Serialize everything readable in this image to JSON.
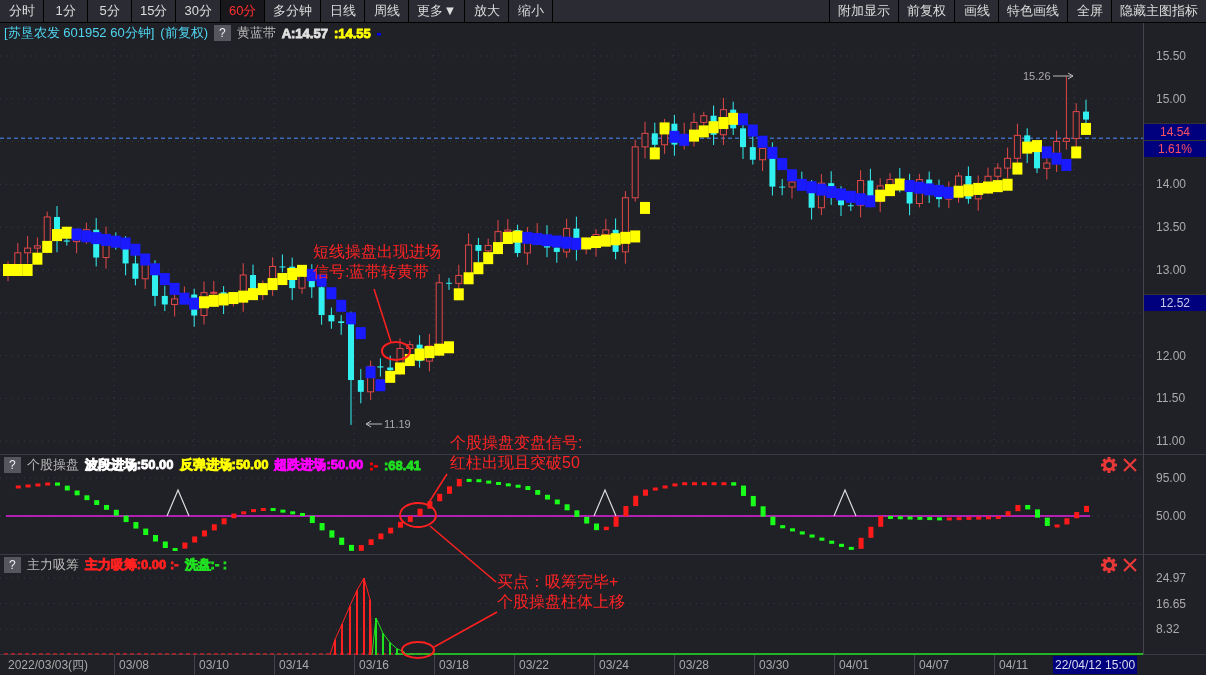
{
  "toolbar": {
    "periods": [
      {
        "label": "分时",
        "selected": false
      },
      {
        "label": "1分",
        "selected": false
      },
      {
        "label": "5分",
        "selected": false
      },
      {
        "label": "15分",
        "selected": false
      },
      {
        "label": "30分",
        "selected": false
      },
      {
        "label": "60分",
        "selected": true
      },
      {
        "label": "多分钟",
        "selected": false
      },
      {
        "label": "日线",
        "selected": false
      },
      {
        "label": "周线",
        "selected": false
      },
      {
        "label": "更多▼",
        "selected": false
      },
      {
        "label": "放大",
        "selected": false
      },
      {
        "label": "缩小",
        "selected": false
      }
    ],
    "actions": [
      "附加显示",
      "前复权",
      "画线",
      "特色画线",
      "全屏",
      "隐藏主图指标"
    ]
  },
  "main_chart": {
    "title": "[苏垦农发 601952 60分钟]",
    "adjust": "(前复权)",
    "help": "?",
    "indicator": "黄蓝带",
    "values": [
      {
        "text": "A:14.57",
        "color": "#e0e0e0"
      },
      {
        "text": ":14.55",
        "color": "#ffff00"
      },
      {
        "text": "-",
        "color": "#0000ff"
      }
    ],
    "axis": [
      "15.50",
      "15.00",
      "14.00",
      "13.50",
      "13.00",
      "12.00",
      "11.50",
      "11.00"
    ],
    "price_tags": [
      {
        "text": "14.54",
        "kind": "price"
      },
      {
        "text": "1.61%",
        "kind": "change"
      },
      {
        "text": "12.52",
        "kind": "cursor"
      }
    ],
    "high_label": "15.26",
    "low_label": "11.19"
  },
  "indicator_1": {
    "help": "?",
    "name": "个股操盘",
    "values": [
      {
        "text": "波段进场:50.00",
        "color": "#ffffff"
      },
      {
        "text": "反弹进场:50.00",
        "color": "#ffff00"
      },
      {
        "text": "超跌进场:50.00",
        "color": "#ff00ff"
      },
      {
        "text": ":-",
        "color": "#ff0000"
      },
      {
        "text": ":68.41",
        "color": "#20e020"
      }
    ],
    "axis": [
      "95.00",
      "50.00"
    ]
  },
  "indicator_2": {
    "help": "?",
    "name": "主力吸筹",
    "values": [
      {
        "text": "主力吸筹:0.00 :-",
        "color": "#ff2020"
      },
      {
        "text": "洗盘:- :",
        "color": "#20e020"
      }
    ],
    "axis": [
      "24.97",
      "16.65",
      "8.32"
    ]
  },
  "dates": [
    "2022/03/03(四)",
    "03/08",
    "03/10",
    "03/14",
    "03/16",
    "03/18",
    "03/22",
    "03/24",
    "03/28",
    "03/30",
    "04/01",
    "04/07",
    "04/11"
  ],
  "cursor_date": "22/04/12 15:00",
  "annotations": [
    {
      "lines": [
        "短线操盘出现进场",
        "信号:蓝带转黄带"
      ]
    },
    {
      "lines": [
        "个股操盘变盘信号:",
        "红柱出现且突破50"
      ]
    },
    {
      "lines": [
        "买点：吸筹完毕+",
        "个股操盘柱体上移"
      ]
    }
  ]
}
